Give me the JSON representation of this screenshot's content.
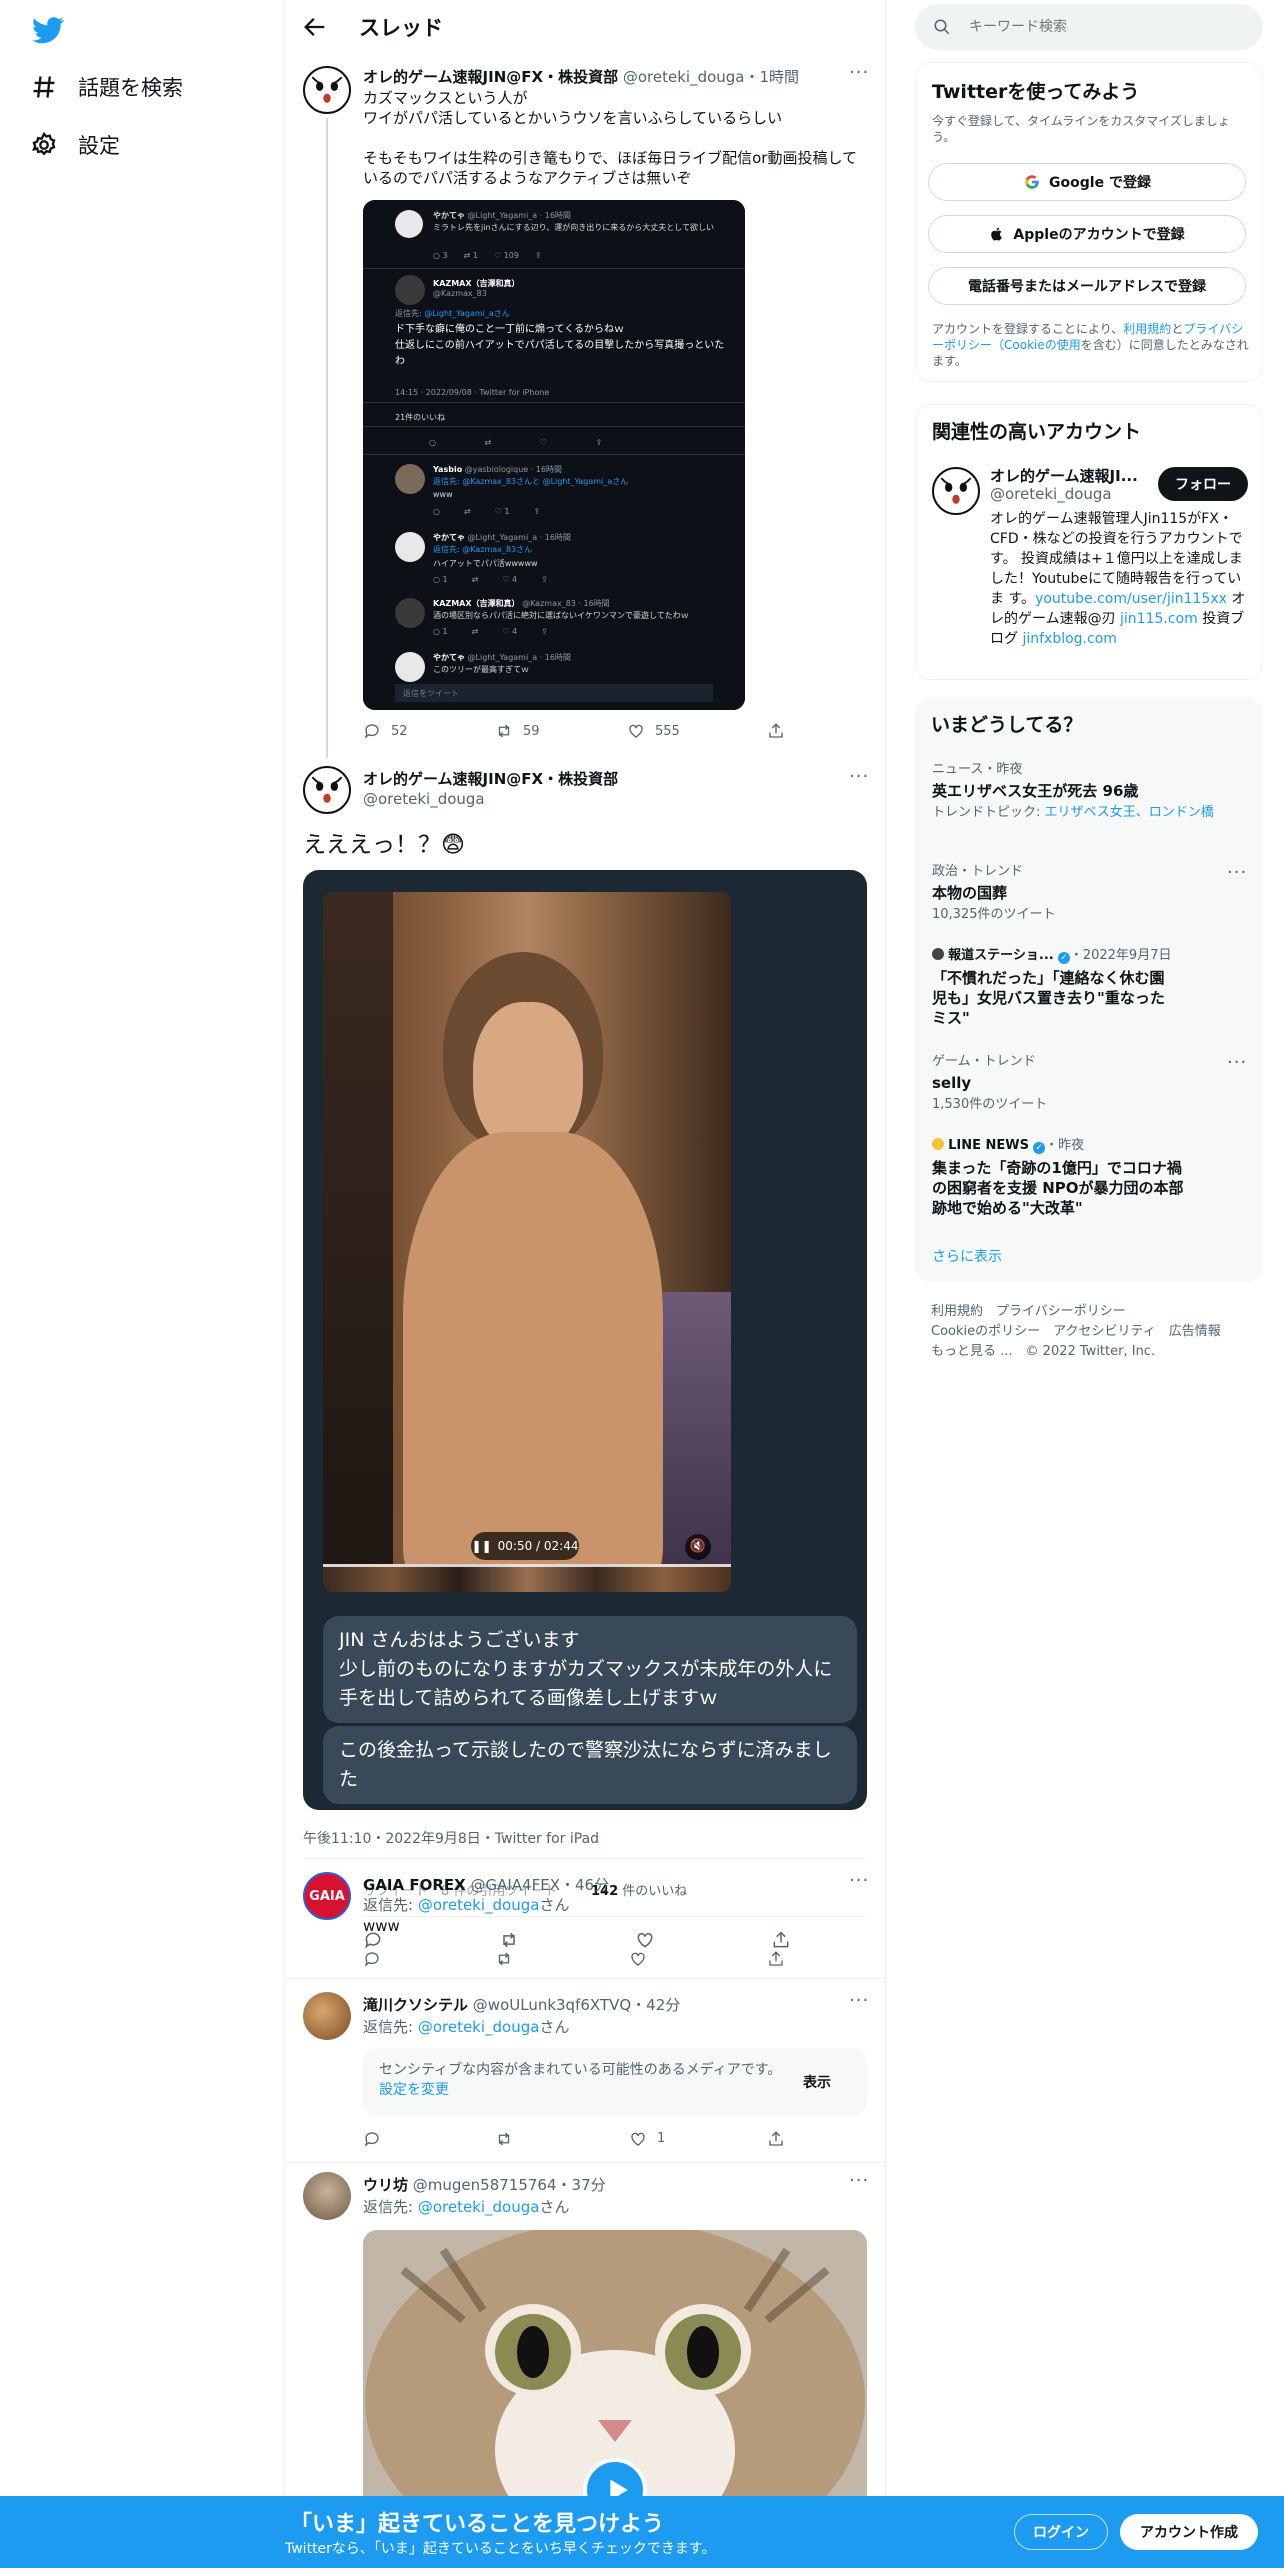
{
  "nav": {
    "explore_label": "話題を検索",
    "settings_label": "設定"
  },
  "header": {
    "title": "スレッド"
  },
  "tweet1": {
    "name": "オレ的ゲーム速報JIN@FX・株投資部",
    "handle": "@oreteki_douga",
    "time": "・1時間",
    "text": "カズマックスという人が\nワイがパパ活しているとかいうウソを言いふらしているらしい\n\nそもそもワイは生粋の引き篭もりで、ほぼ毎日ライブ配信or動画投稿しているのでパパ活するようなアクティブさは無いぞ",
    "replies": "52",
    "retweets": "59",
    "likes": "555",
    "embedded": {
      "reply1_name": "やかてゃ",
      "reply1_handle": "@Light_Yagami_a · 16時間",
      "reply1_text": "ミラトレ先をjinさんにする辺り、運が向き出りに来るから大丈夫として欲しい",
      "main_name": "KAZMAX（吉澤和真）",
      "main_handle": "@Kazmax_83",
      "main_replyto_label": "返信先: ",
      "main_replyto": "@Light_Yagami_aさん",
      "main_text": "ド下手な癖に俺のこと一丁前に煽ってくるからねｗ\n仕返しにこの前ハイアットでパパ活してるの目撃したから写真撮っといたわ",
      "main_meta": "14:15 · 2022/09/08 · Twitter for iPhone",
      "main_likes": "21件のいいね",
      "r2_name": "Yasbio",
      "r2_handle": "@yasbiologique · 16時間",
      "r2_replyto": "返信先: @Kazmax_83さんと @Light_Yagami_aさん",
      "r2_text": "www",
      "r3_name": "やかてゃ",
      "r3_handle": "@Light_Yagami_a · 16時間",
      "r3_replyto": "返信先: @Kazmax_83さん",
      "r3_text": "ハイアットでパパ活wwwww",
      "r4_name": "KAZMAX（吉澤和真）",
      "r4_handle": "@Kazmax_83 · 16時間",
      "r4_text": "酒の場区別ならパパ活に絶対に選ばないイケワンマンで豪遊してたわｗ",
      "r5_name": "やかてゃ",
      "r5_handle": "@Light_Yagami_a · 16時間",
      "r5_text": "このツリーが最高すぎてｗ",
      "reply_box": "返信をツイート"
    }
  },
  "tweet2": {
    "name": "オレ的ゲーム速報JIN@FX・株投資部",
    "handle": "@oreteki_douga",
    "text": "えええっ！？😨",
    "video_time": "00:50 / 02:44",
    "bubble1": "JIN さんおはようございます\n少し前のものになりますがカズマックスが未成年の外人に手を出して詰められてる画像差し上げますｗ",
    "bubble2": "この後金払って示談したので警察沙汰にならずに済みました",
    "meta": "午後11:10・2022年9月8日・Twitter for iPad",
    "overlap_text": "リツイート　8 件の引用ツイート",
    "likes_num": "142",
    "likes_label": "件のいいね"
  },
  "reply_gaia": {
    "name": "GAIA FOREX",
    "handle": "@GAIA4FEX",
    "time": "・46分",
    "replyto_label": "返信先: ",
    "replyto": "@oreteki_douga",
    "replyto_suffix": "さん",
    "text": "www"
  },
  "reply_taki": {
    "name": "滝川クソシテル",
    "handle": "@woULunk3qf6XTVQ",
    "time": "・42分",
    "replyto_label": "返信先: ",
    "replyto": "@oreteki_douga",
    "replyto_suffix": "さん",
    "sensitive_text": "センシティブな内容が含まれている可能性のあるメディアです。",
    "sensitive_link": "設定を変更",
    "show_label": "表示",
    "likes": "1"
  },
  "reply_uri": {
    "name": "ウリ坊",
    "handle": "@mugen58715764",
    "time": "・37分",
    "replyto_label": "返信先: ",
    "replyto": "@oreteki_douga",
    "replyto_suffix": "さん"
  },
  "search": {
    "placeholder": "キーワード検索"
  },
  "signup": {
    "title": "Twitterを使ってみよう",
    "subtitle": "今すぐ登録して、タイムラインをカスタマイズしましょう。",
    "google": "Google で登録",
    "apple": "Appleのアカウントで登録",
    "phone": "電話番号またはメールアドレスで登録",
    "legal_1": "アカウントを登録することにより、",
    "legal_link1": "利用規約",
    "legal_2": "と",
    "legal_link2": "プライバシーポリシー（Cookieの使用",
    "legal_3": "を含む）に同意したとみなされます。"
  },
  "relevant": {
    "title": "関連性の高いアカウント",
    "name": "オレ的ゲーム速報JI...",
    "handle": "@oreteki_douga",
    "follow": "フォロー",
    "bio_1": "オレ的ゲーム速報管理人Jin115がFX・CFD・株などの投資を行うアカウントです。 投資成績は+１億円以上を達成しました！Youtubeにて随時報告を行っていま す。",
    "bio_link1": "youtube.com/user/jin115xx",
    "bio_2": " オレ的ゲーム速報@刃 ",
    "bio_link2": "jin115.com",
    "bio_3": " 投資ブログ ",
    "bio_link3": "jinfxblog.com"
  },
  "trends": {
    "title": "いまどうしてる？",
    "items": [
      {
        "meta": "ニュース・昨夜",
        "title": "英エリザベス女王が死去 96歳",
        "sub_label": "トレンドトピック: ",
        "sub_link": "エリザベス女王、ロンドン橋"
      },
      {
        "meta": "政治・トレンド",
        "title": "本物の国葬",
        "sub": "10,325件のツイート"
      },
      {
        "meta_source": "報道ステーショ...",
        "meta_date": "・2022年9月7日",
        "title": "「不慣れだった」「連絡なく休む園児も」女児バス置き去り\"重なったミス\""
      },
      {
        "meta": "ゲーム・トレンド",
        "title": "selly",
        "sub": "1,530件のツイート"
      },
      {
        "meta_source": "LINE NEWS",
        "meta_date": "・昨夜",
        "title": "集まった「奇跡の1億円」でコロナ禍の困窮者を支援 NPOが暴力団の本部跡地で始める\"大改革\""
      }
    ],
    "show_more": "さらに表示"
  },
  "footer": {
    "links_row1": [
      "利用規約",
      "プライバシーポリシー"
    ],
    "links_row2": [
      "Cookieのポリシー",
      "アクセシビリティ",
      "広告情報"
    ],
    "more": "もっと見る ...",
    "copyright": "© 2022 Twitter, Inc."
  },
  "bottom_bar": {
    "headline": "「いま」起きていることを見つけよう",
    "subline": "Twitterなら、「いま」起きていることをいち早くチェックできます。",
    "login": "ログイン",
    "signup": "アカウント作成"
  },
  "colors": {
    "accent": "#1d9bf0",
    "text": "#0f1419",
    "muted": "#536471"
  }
}
